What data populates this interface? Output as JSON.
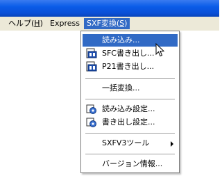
{
  "menubar": {
    "items": [
      {
        "label": "ヘルプ(",
        "mnemonic": "H",
        "suffix": ")"
      },
      {
        "label": "Express",
        "mnemonic": "",
        "suffix": ""
      },
      {
        "label": "SXF変換(",
        "mnemonic": "S",
        "suffix": ")"
      }
    ]
  },
  "dropdown": {
    "items": [
      {
        "label": "読み込み...",
        "icon": "none",
        "highlighted": true
      },
      {
        "label": "SFC書き出し...",
        "icon": "sfc-file-icon"
      },
      {
        "label": "P21書き出し...",
        "icon": "p21-file-icon"
      },
      {
        "label": "一括変換...",
        "icon": "none"
      },
      {
        "label": "読み込み設定...",
        "icon": "settings-icon"
      },
      {
        "label": "書き出し設定...",
        "icon": "settings-icon"
      },
      {
        "label": "SXFV3ツール",
        "icon": "none",
        "submenu": true
      },
      {
        "label": "バージョン情報...",
        "icon": "none"
      }
    ]
  },
  "colors": {
    "highlight": "#316ac5",
    "menubar": "#ece9d8",
    "titlebar": "#0a5ce8"
  }
}
